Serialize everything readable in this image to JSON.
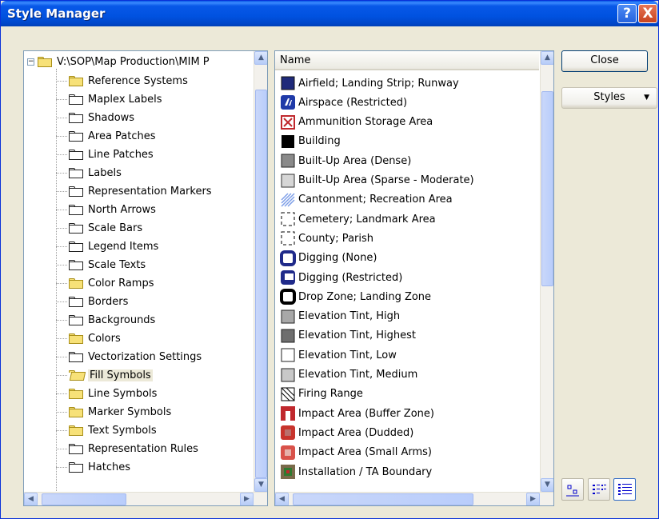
{
  "window": {
    "title": "Style Manager"
  },
  "titlebar_buttons": {
    "help": "?",
    "close": "X"
  },
  "tree": {
    "root_label": "V:\\SOP\\Map Production\\MIM P",
    "items": [
      {
        "label": "Reference Systems",
        "folder": "yellow"
      },
      {
        "label": "Maplex Labels",
        "folder": "white"
      },
      {
        "label": "Shadows",
        "folder": "white"
      },
      {
        "label": "Area Patches",
        "folder": "white"
      },
      {
        "label": "Line Patches",
        "folder": "white"
      },
      {
        "label": "Labels",
        "folder": "white"
      },
      {
        "label": "Representation Markers",
        "folder": "white"
      },
      {
        "label": "North Arrows",
        "folder": "white"
      },
      {
        "label": "Scale Bars",
        "folder": "white"
      },
      {
        "label": "Legend Items",
        "folder": "white"
      },
      {
        "label": "Scale Texts",
        "folder": "white"
      },
      {
        "label": "Color Ramps",
        "folder": "yellow"
      },
      {
        "label": "Borders",
        "folder": "white"
      },
      {
        "label": "Backgrounds",
        "folder": "white"
      },
      {
        "label": "Colors",
        "folder": "yellow"
      },
      {
        "label": "Vectorization Settings",
        "folder": "white"
      },
      {
        "label": "Fill Symbols",
        "folder": "open",
        "selected": true
      },
      {
        "label": "Line Symbols",
        "folder": "yellow"
      },
      {
        "label": "Marker Symbols",
        "folder": "yellow"
      },
      {
        "label": "Text Symbols",
        "folder": "yellow"
      },
      {
        "label": "Representation Rules",
        "folder": "white"
      },
      {
        "label": "Hatches",
        "folder": "white"
      }
    ]
  },
  "list": {
    "column_header": "Name",
    "items": [
      {
        "label": "Airfield; Landing Strip; Runway",
        "symbol": "navy-square-icon"
      },
      {
        "label": "Airspace (Restricted)",
        "symbol": "airspace-icon"
      },
      {
        "label": "Ammunition Storage Area",
        "symbol": "red-cross-box-icon"
      },
      {
        "label": "Building",
        "symbol": "black-square-icon"
      },
      {
        "label": "Built-Up Area (Dense)",
        "symbol": "gray-square-icon"
      },
      {
        "label": "Built-Up Area (Sparse - Moderate)",
        "symbol": "lightgray-square-icon"
      },
      {
        "label": "Cantonment; Recreation Area",
        "symbol": "blue-hatch-icon"
      },
      {
        "label": "Cemetery; Landmark Area",
        "symbol": "dashed-square-icon"
      },
      {
        "label": "County; Parish",
        "symbol": "dashed-square-icon"
      },
      {
        "label": "Digging (None)",
        "symbol": "navy-outline-icon"
      },
      {
        "label": "Digging (Restricted)",
        "symbol": "navy-corner-icon"
      },
      {
        "label": "Drop Zone; Landing Zone",
        "symbol": "black-outline-icon"
      },
      {
        "label": "Elevation Tint, High",
        "symbol": "midgray-square-icon"
      },
      {
        "label": "Elevation Tint, Highest",
        "symbol": "darkgray-square-icon"
      },
      {
        "label": "Elevation Tint, Low",
        "symbol": "white-square-icon"
      },
      {
        "label": "Elevation Tint, Medium",
        "symbol": "pale-square-icon"
      },
      {
        "label": "Firing Range",
        "symbol": "diagonal-square-icon"
      },
      {
        "label": "Impact Area (Buffer Zone)",
        "symbol": "red-bracket-icon"
      },
      {
        "label": "Impact Area (Dudded)",
        "symbol": "red-rounded-icon"
      },
      {
        "label": "Impact Area (Small Arms)",
        "symbol": "red-rounded-light-icon"
      },
      {
        "label": "Installation / TA Boundary",
        "symbol": "installation-icon"
      }
    ]
  },
  "buttons": {
    "close": "Close",
    "styles": "Styles"
  },
  "view_buttons": [
    "view-large-icons-icon",
    "view-list-icon",
    "view-details-icon"
  ]
}
